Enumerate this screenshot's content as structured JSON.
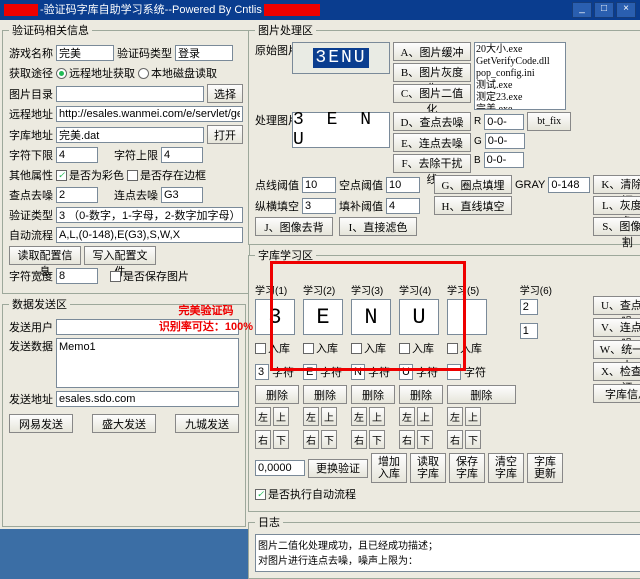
{
  "title": "-验证码字库自助学习系统--Powered By Cntlis",
  "left": {
    "grp1": "验证码相关信息",
    "gameName": "游戏名称",
    "gameNameV": "完美",
    "codeType": "验证码类型",
    "codeTypeV": "登录",
    "getPath": "获取途径",
    "getPathA": "远程地址获取",
    "getPathB": "本地磁盘读取",
    "picDir": "图片目录",
    "picDirV": "",
    "browse": "选择",
    "remoteAddr": "远程地址",
    "remoteAddrV": "http://esales.wanmei.com/e/servlet/getra",
    "libAddr": "字库地址",
    "libAddrV": "完美.dat",
    "open": "打开",
    "charLow": "字符下限",
    "charLowV": "4",
    "charUp": "字符上限",
    "charUpV": "4",
    "other": "其他属性",
    "otherA": "是否为彩色",
    "otherB": "是否存在边框",
    "qd": "查点去噪",
    "qdV": "2",
    "ld": "连点去噪",
    "ldV": "G3",
    "codeCat": "验证类型",
    "codeCatV": "3 （0-数字，1-字母，2-数字加字母）",
    "autoFlow": "自动流程",
    "autoFlowV": "A,L,(0-148),E(G3),S,W,X",
    "readCfg": "读取配置信息",
    "writeCfg": "写入配置文件",
    "charW": "字符宽度",
    "charWV": "8",
    "saveImg": "是否保存图片",
    "grp2": "数据发送区",
    "sendUser": "发送用户",
    "sendUserV": "",
    "sendData": "发送数据",
    "sendDataV": "Memo1",
    "sendAddr": "发送地址",
    "sendAddrV": "esales.sdo.com",
    "btnNE": "网易发送",
    "btnSD": "盛大发送",
    "btnNC": "九城发送"
  },
  "right": {
    "grp1": "图片处理区",
    "orig": "原始图片",
    "origText": "3ENU",
    "btnA": "A、图片缓冲",
    "btnB": "B、图片灰度化",
    "btnC": "C、图片二值化",
    "btnD": "D、查点去噪",
    "btnE": "E、连点去噪",
    "btnF": "F、去除干扰线",
    "btnG": "G、圈点填埋",
    "btnH": "H、直线填空",
    "btnI": "I、直接滤色",
    "btnJ": "J、图像去背",
    "btnS": "S、图像分割",
    "btnK": "K、清除验证",
    "btnL": "L、灰度滤色",
    "files": "20大小.exe\nGetVerifyCode.dll\npop_config.ini\n测试.exe\n测定23.exe\n完美.exe\n完美.dat全部信息",
    "proc": "处理图片",
    "procText": "3 E N U",
    "btfix": "bt_fix",
    "R": "R",
    "G": "G",
    "B": "B",
    "r0": "0-0-",
    "g0": "0-0-",
    "b0": "0-0-",
    "dot": "点线阈值",
    "dotV": "10",
    "blank": "空点阈值",
    "blankV": "10",
    "grayL": "GRAY",
    "grayV": "0-148",
    "hv": "纵横填空",
    "hvV": "3",
    "fill": "填补阈值",
    "fillV": "4",
    "grp2": "字库学习区",
    "hdr": "学习(1)  学习(2)  学习(3)  学习(4)",
    "h5": "学习(5)",
    "h6": "学习(6)",
    "chars": [
      "3",
      "E",
      "N",
      "U"
    ],
    "inlib": "入库",
    "charL": "字符",
    "del": "删除",
    "left": "左",
    "up": "上",
    "right": "右",
    "down": "下",
    "spin": "0,0000",
    "btnReload": "更换验证",
    "btnAdd": "增加\n入库",
    "btnRead": "读取\n字库",
    "btnSave": "保存\n字库",
    "btnClear": "清空\n字库",
    "btnUpd": "字库\n更新",
    "autoRun": "是否执行自动流程",
    "btnU": "U、查点去噪",
    "btnV": "V、连点去噪",
    "btnW": "W、统一大小",
    "btnX": "X、检查验证",
    "btnLib": "字库信息",
    "num1": "2",
    "num2": "1",
    "grp3": "日志",
    "log": "图片二值化处理成功，且已经成功描述；\n对图片进行连点去噪，噪声上限为："
  },
  "promo": "完美验证码\n识别率可达：100%"
}
